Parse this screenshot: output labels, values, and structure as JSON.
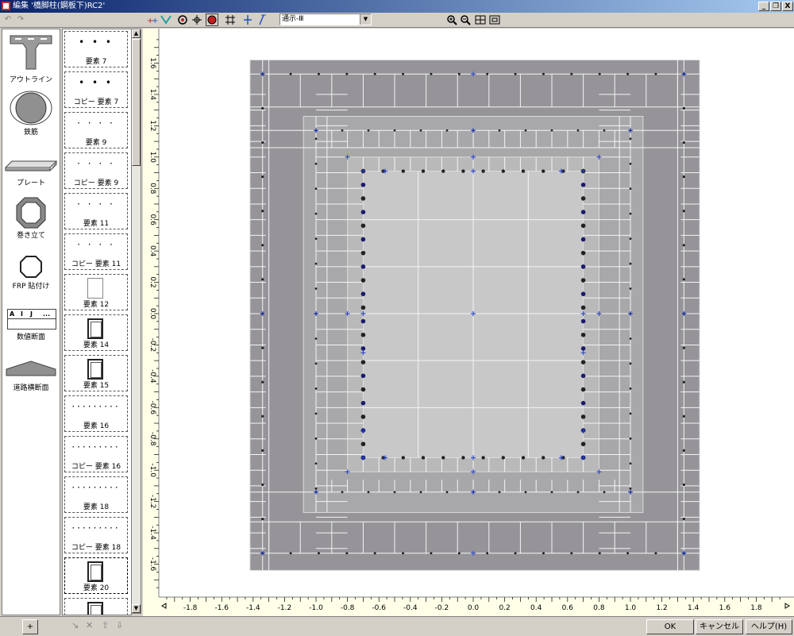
{
  "window": {
    "title": "編集 '橋脚柱(鋼板下)RC2'",
    "minimize": "_",
    "restore": "❐",
    "close": "X"
  },
  "toolbar": {
    "undo": "↶",
    "redo": "↷",
    "view_combo_value": "通示-Ⅲ",
    "zoom_in": "⊕",
    "zoom_out": "⊖"
  },
  "palette": [
    {
      "label": "アウトライン",
      "icon": "outline-icon"
    },
    {
      "label": "鉄筋",
      "icon": "rebar-icon"
    },
    {
      "label": "プレート",
      "icon": "plate-icon"
    },
    {
      "label": "巻き立て",
      "icon": "jacket-icon"
    },
    {
      "label": "FRP 貼付け",
      "icon": "frp-icon"
    },
    {
      "label": "数値断面",
      "icon": "numeric-section-icon",
      "cells": [
        "A",
        "I",
        "J",
        "..."
      ]
    },
    {
      "label": "道路横断面",
      "icon": "road-section-icon"
    }
  ],
  "elements": [
    {
      "label": "要素 7",
      "preview": "• • •"
    },
    {
      "label": "コピー 要素 7",
      "preview": "• • •"
    },
    {
      "label": "要素 9",
      "preview": "· · · ·"
    },
    {
      "label": "コピー 要素 9",
      "preview": "· · · ·"
    },
    {
      "label": "要素 11",
      "preview": "· · · ·"
    },
    {
      "label": "コピー 要素 11",
      "preview": "· · · ·"
    },
    {
      "label": "要素 12",
      "preview": "rect"
    },
    {
      "label": "要素 14",
      "preview": "rect2"
    },
    {
      "label": "要素 15",
      "preview": "rect2"
    },
    {
      "label": "要素 16",
      "preview": "·········"
    },
    {
      "label": "コピー 要素 16",
      "preview": "·········"
    },
    {
      "label": "要素 18",
      "preview": "·········"
    },
    {
      "label": "コピー 要素 18",
      "preview": "·········"
    },
    {
      "label": "要素 20",
      "preview": "rect2"
    },
    {
      "label": "",
      "preview": "rect2"
    }
  ],
  "axes": {
    "x_ticks": [
      "-1.8",
      "-1.6",
      "-1.4",
      "-1.2",
      "-1.0",
      "-0.8",
      "-0.6",
      "-0.4",
      "-0.2",
      "0.0",
      "0.2",
      "0.4",
      "0.6",
      "0.8",
      "1.0",
      "1.2",
      "1.4",
      "1.6",
      "1.8"
    ],
    "y_ticks": [
      "1.6",
      "1.4",
      "1.2",
      "1.0",
      "0.8",
      "0.6",
      "0.4",
      "0.2",
      "0.0",
      "-0.2",
      "-0.4",
      "-0.6",
      "-0.8",
      "-1.0",
      "-1.2",
      "-1.4",
      "-1.6"
    ],
    "x_range": [
      -1.98,
      2.0
    ],
    "y_range": [
      -1.78,
      1.78
    ]
  },
  "section": {
    "outer_x": [
      -1.42,
      1.44
    ],
    "outer_y": [
      -1.64,
      1.62
    ],
    "jacket_x": [
      -1.08,
      1.08
    ],
    "jacket_y": [
      -1.27,
      1.26
    ],
    "core_x": [
      -0.8,
      0.8
    ],
    "core_y": [
      -1.01,
      1.0
    ],
    "inner_x": [
      -0.7,
      0.7
    ],
    "inner_y": [
      -0.92,
      0.91
    ],
    "colors": {
      "outer": "#969499",
      "core": "#b9b9b9",
      "inner": "#c8c8c8",
      "grid": "#f4f4f4",
      "rebar": "#222222",
      "rebar_blue": "#1a1a6e",
      "marker": "#2040d0"
    }
  },
  "footer": {
    "ok": "OK",
    "cancel": "キャンセル",
    "help": "ヘルプ(H)",
    "add": "+"
  }
}
